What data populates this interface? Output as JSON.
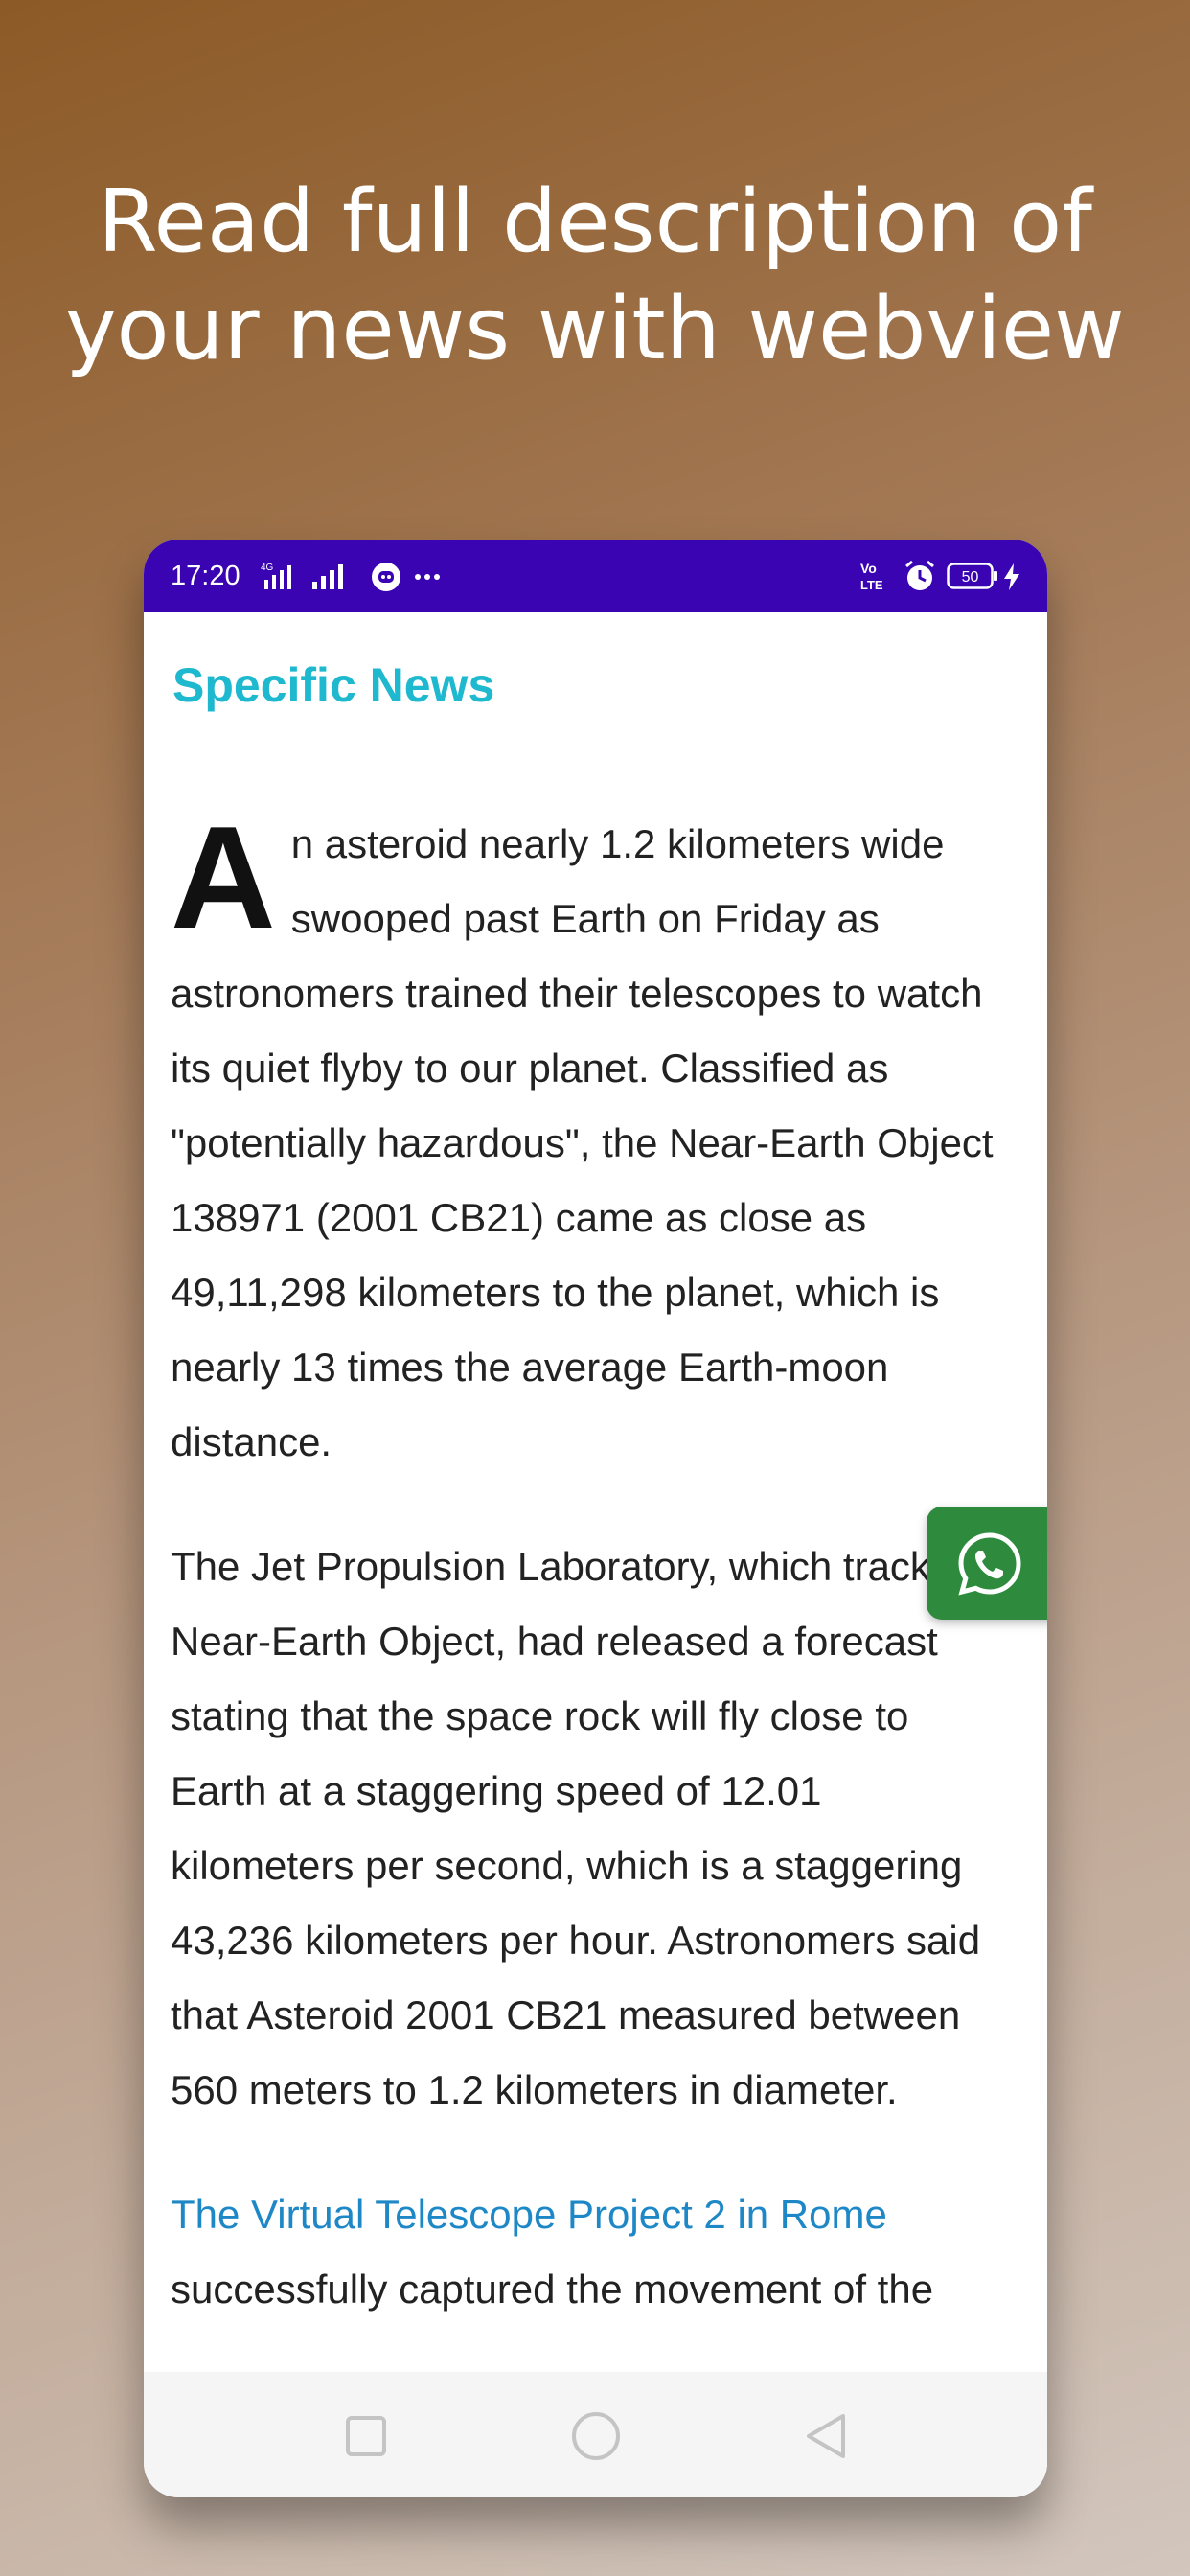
{
  "promo": {
    "title_line1": "Read full description of",
    "title_line2": "your news with webview"
  },
  "status_bar": {
    "time": "17:20",
    "network_type": "4G",
    "battery": "50",
    "volte": "Vo LTE",
    "color": "#3a04b3",
    "icons": [
      "signal-icon",
      "signal-icon",
      "discord-icon",
      "more-dots-icon",
      "volte-icon",
      "alarm-icon",
      "battery-icon",
      "charging-icon"
    ]
  },
  "app": {
    "title": "Specific News",
    "title_color": "#1eb8cf"
  },
  "article": {
    "dropcap": "A",
    "p1_rest": "n asteroid nearly 1.2 kilometers wide swooped past Earth on Friday as astronomers trained their telescopes to watch its quiet flyby to our planet. Classified as \"potentially hazardous\", the Near-Earth Object 138971 (2001 CB21) came as close as 49,11,298 kilometers to the planet, which is nearly 13 times the average Earth-moon distance.",
    "p2": "The Jet Propulsion Laboratory, which tracks Near-Earth Object, had released a forecast stating that the space rock will fly close to Earth at a staggering speed of 12.01 kilometers per second, which is a staggering 43,236 kilometers per hour. Astronomers said that Asteroid 2001 CB21 measured between 560 meters to 1.2 kilometers in diameter.",
    "p3_link": "The Virtual Telescope Project 2 in Rome",
    "p3_rest": " successfully captured the movement of the",
    "link_color": "#1e88c7"
  },
  "fab": {
    "icon": "whatsapp-icon",
    "color": "#2e8b3d"
  },
  "nav_bar": {
    "icons": [
      "square-recents-icon",
      "circle-home-icon",
      "triangle-back-icon"
    ]
  }
}
